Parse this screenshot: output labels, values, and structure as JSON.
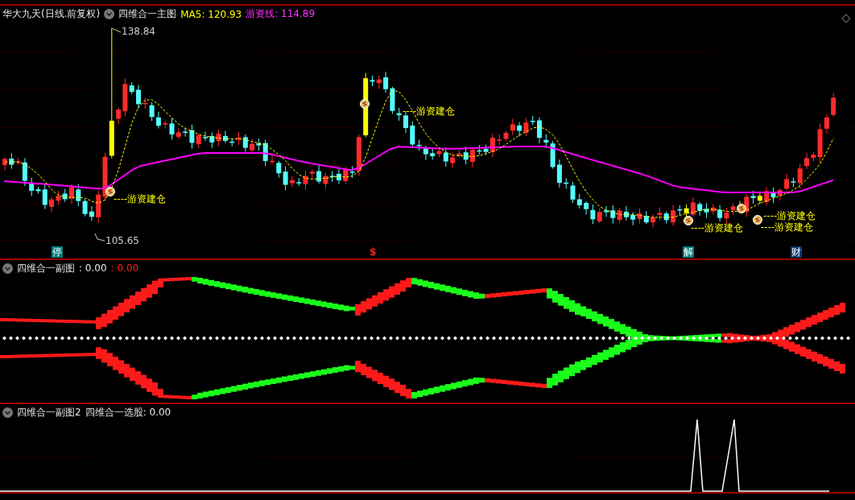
{
  "main": {
    "stock": "华大九天(日线.前复权)",
    "indicator": "四维合一主图",
    "ma5": "MA5: 120.93",
    "line": "游资线: 114.89",
    "high_label": "138.84",
    "low_label": "105.65",
    "signals": [
      "----游资建仓",
      "----游资建仓",
      "----游资建仓",
      "----游资建仓",
      "----游资建仓"
    ],
    "events": [
      {
        "label": "停",
        "kind": "suspend"
      },
      {
        "label": "$",
        "kind": "dividend"
      },
      {
        "label": "解",
        "kind": "unlock"
      },
      {
        "label": "财",
        "kind": "report"
      }
    ]
  },
  "sub1": {
    "title": "四维合一副图",
    "value1": ": 0.00",
    "value2": ": 0.00"
  },
  "sub2": {
    "title": "四维合一副图2",
    "value": "四维合一选股: 0.00"
  }
}
